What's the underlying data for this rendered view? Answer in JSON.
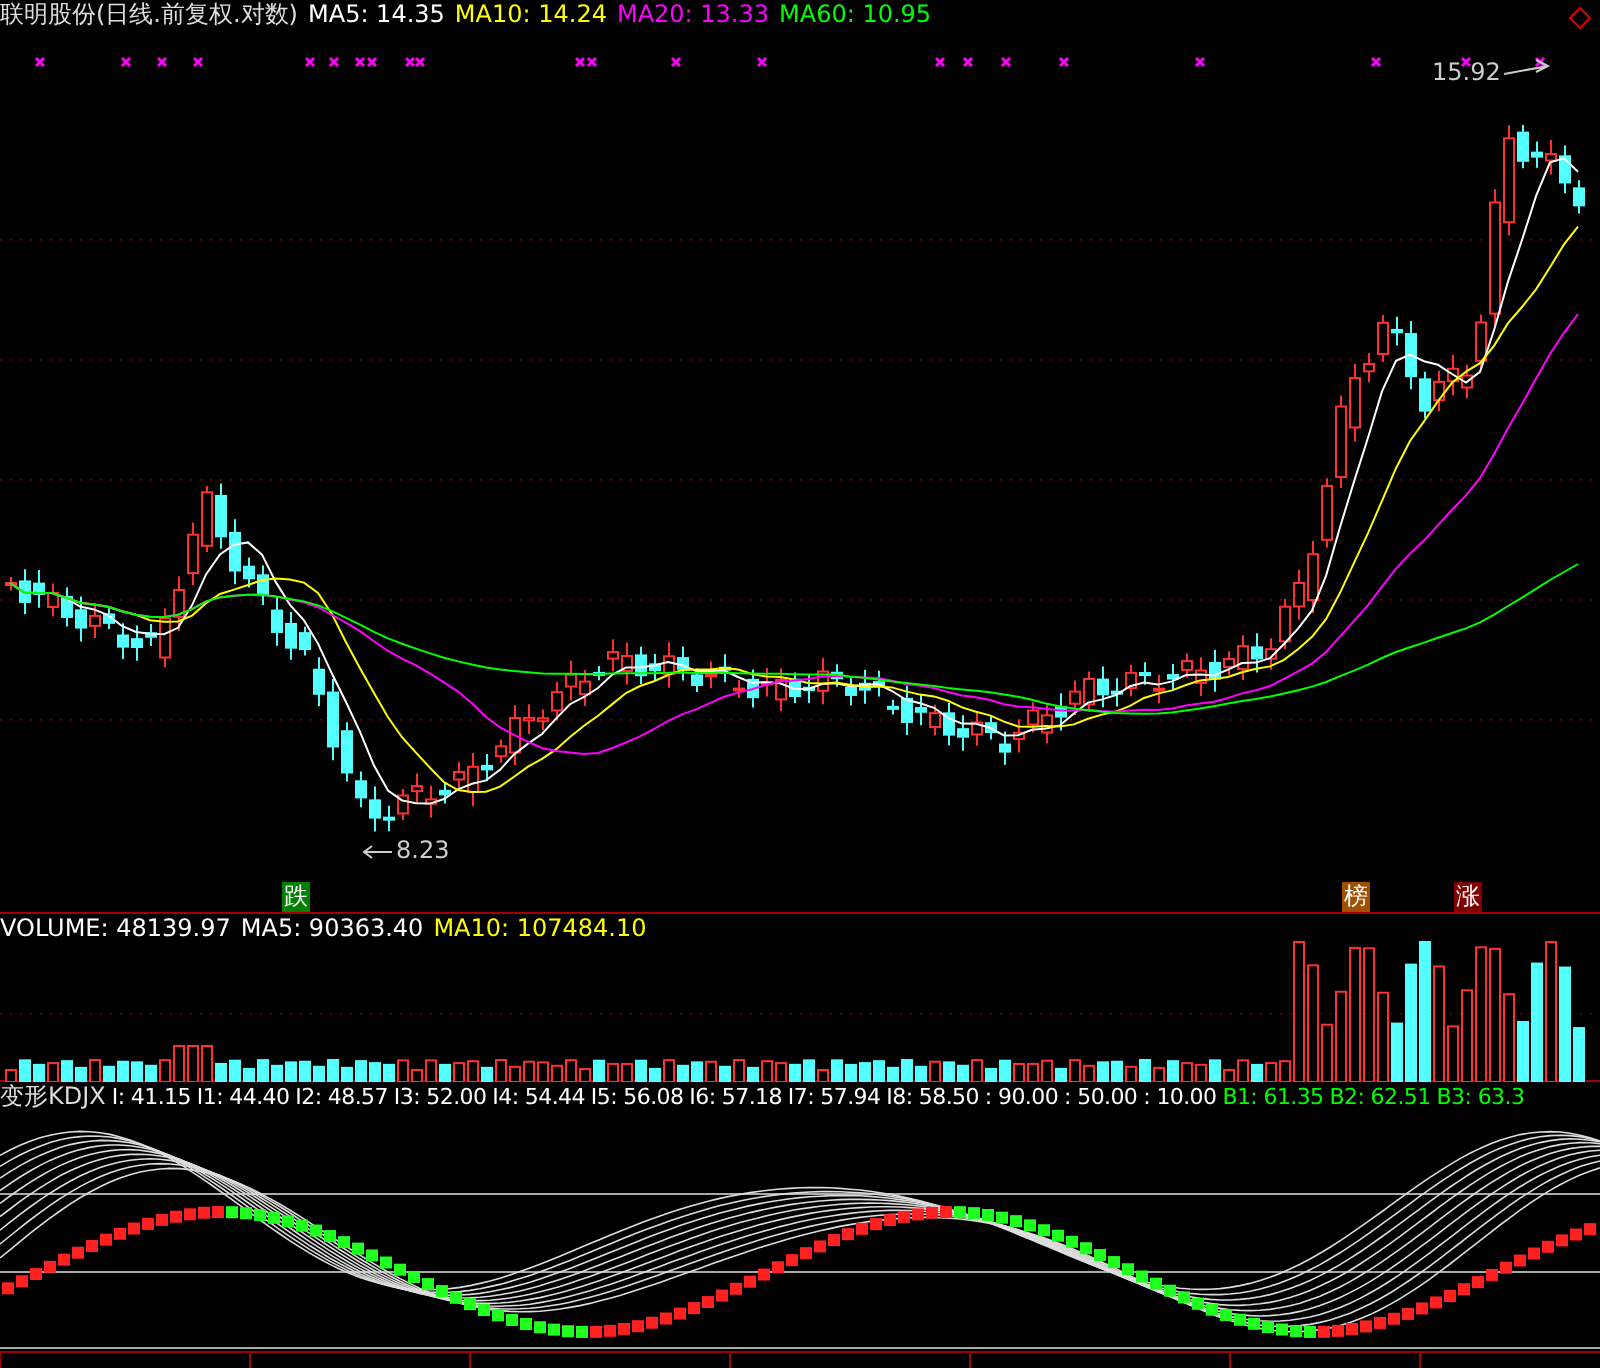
{
  "price_panel": {
    "title": "联明股份(日线.前复权.对数)",
    "legend": [
      {
        "label": "MA5: 14.35",
        "color": "#ffffff"
      },
      {
        "label": "MA10: 14.24",
        "color": "#ffff00"
      },
      {
        "label": "MA20: 13.33",
        "color": "#ff00ff"
      },
      {
        "label": "MA60: 10.95",
        "color": "#00ff00"
      }
    ],
    "high_label": "15.92",
    "low_label": "8.23",
    "signals": [
      {
        "label": "跌",
        "color": "#008000"
      },
      {
        "label": "榜",
        "color": "#a05000"
      },
      {
        "label": "涨",
        "color": "#800000"
      }
    ]
  },
  "volume_panel": {
    "legend": [
      {
        "label": "VOLUME: 48139.97",
        "color": "#ffffff"
      },
      {
        "label": "MA5: 90363.40",
        "color": "#ffffff"
      },
      {
        "label": "MA10: 107484.10",
        "color": "#ffff00"
      }
    ]
  },
  "kdj_panel": {
    "title": "变形KDJX",
    "legend": [
      {
        "label": "I: 41.15",
        "color": "#ffffff"
      },
      {
        "label": "I1: 44.40",
        "color": "#ffffff"
      },
      {
        "label": "I2: 48.57",
        "color": "#ffffff"
      },
      {
        "label": "I3: 52.00",
        "color": "#ffffff"
      },
      {
        "label": "I4: 54.44",
        "color": "#ffffff"
      },
      {
        "label": "I5: 56.08",
        "color": "#ffffff"
      },
      {
        "label": "I6: 57.18",
        "color": "#ffffff"
      },
      {
        "label": "I7: 57.94",
        "color": "#ffffff"
      },
      {
        "label": "I8: 58.50",
        "color": "#ffffff"
      },
      {
        "label": ": 90.00",
        "color": "#ffffff"
      },
      {
        "label": ": 50.00",
        "color": "#ffffff"
      },
      {
        "label": ": 10.00",
        "color": "#ffffff"
      },
      {
        "label": "B1: 61.35",
        "color": "#00ff00"
      },
      {
        "label": "B2: 62.51",
        "color": "#00ff00"
      },
      {
        "label": "B3: 63.3",
        "color": "#00ff00"
      }
    ]
  }
}
